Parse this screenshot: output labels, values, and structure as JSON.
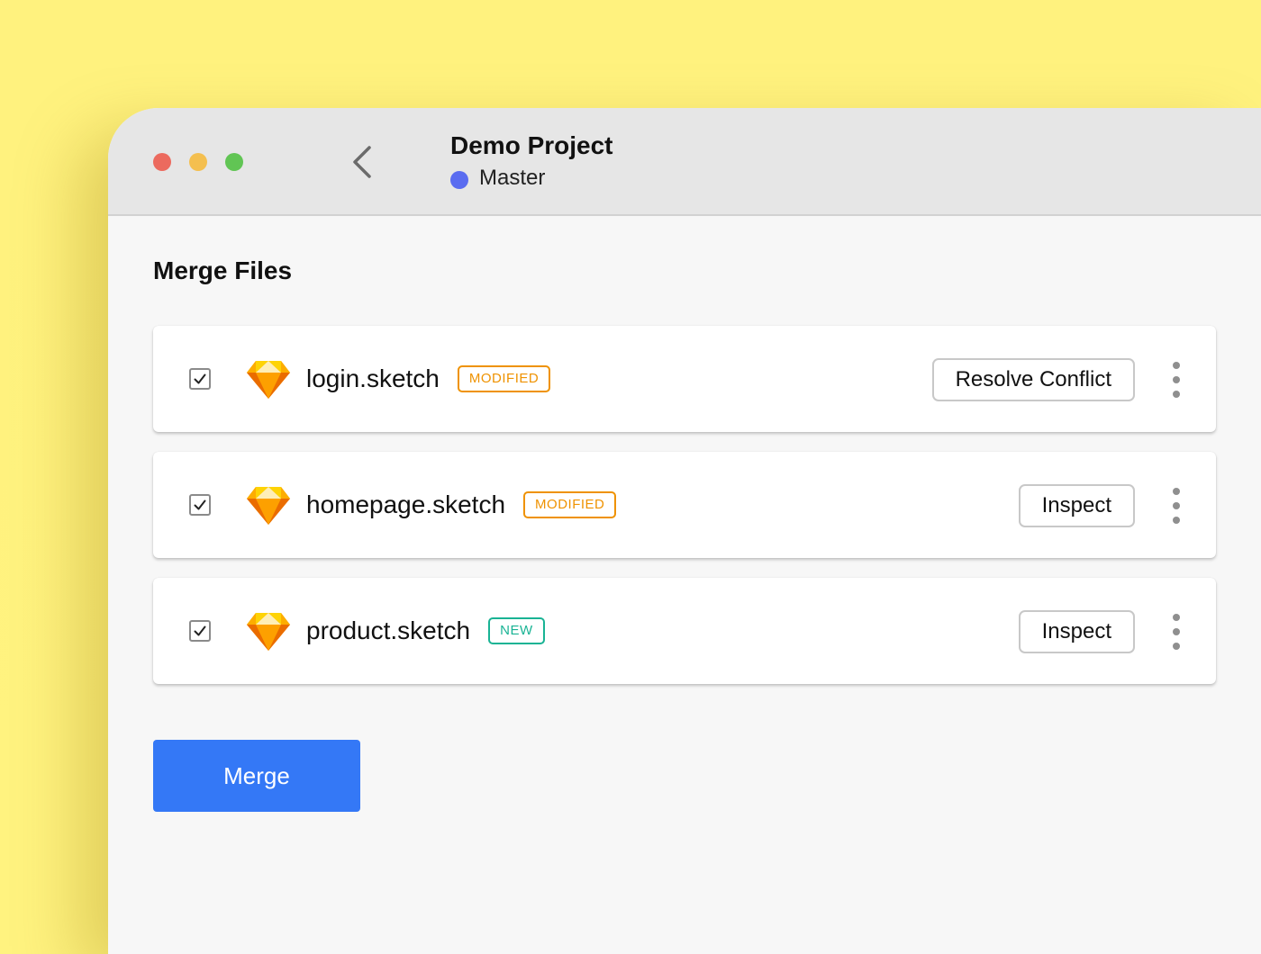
{
  "colors": {
    "traffic_red": "#ec6a5e",
    "traffic_yellow": "#f4bf4f",
    "traffic_green": "#61c554",
    "branch_dot": "#5a6cf0",
    "badge_modified": "#ef9200",
    "badge_new": "#19b394",
    "primary": "#3478f6"
  },
  "header": {
    "title": "Demo Project",
    "branch": "Master",
    "back_icon": "chevron-left-icon"
  },
  "section_title": "Merge Files",
  "files": [
    {
      "name": "login.sketch",
      "badge": "MODIFIED",
      "badge_type": "modified",
      "action": "Resolve Conflict",
      "checked": true,
      "icon": "sketch-icon"
    },
    {
      "name": "homepage.sketch",
      "badge": "MODIFIED",
      "badge_type": "modified",
      "action": "Inspect",
      "checked": true,
      "icon": "sketch-icon"
    },
    {
      "name": "product.sketch",
      "badge": "NEW",
      "badge_type": "new",
      "action": "Inspect",
      "checked": true,
      "icon": "sketch-icon"
    }
  ],
  "merge_button": "Merge"
}
